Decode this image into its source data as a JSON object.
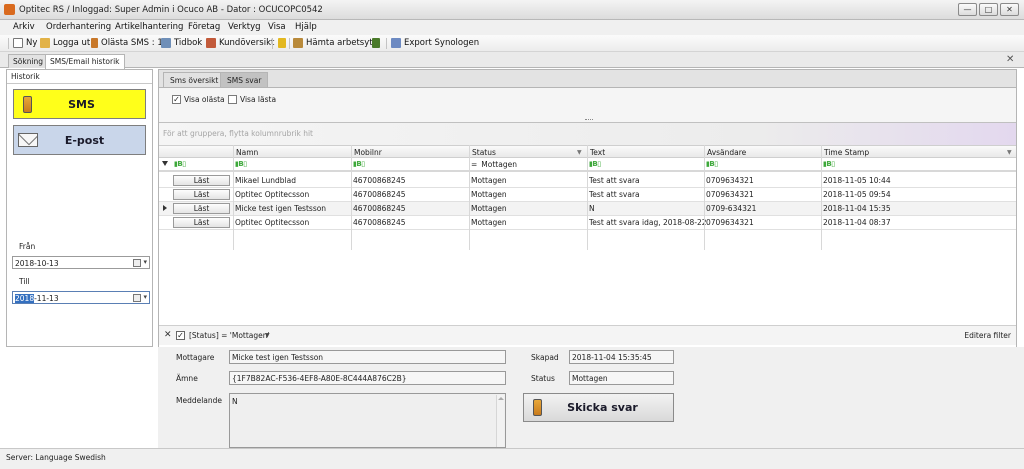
{
  "window": {
    "title": "Optitec RS / Inloggad: Super Admin i  Ocuco AB - Dator : OCUCOPC0542",
    "min": "—",
    "max": "□",
    "close": "✕"
  },
  "menu": [
    "Arkiv",
    "Orderhantering",
    "Artikelhantering",
    "Företag",
    "Verktyg",
    "Visa",
    "Hjälp"
  ],
  "toolbar": {
    "new": "Ny",
    "logout": "Logga ut",
    "unread_sms": "Olästa SMS : 1",
    "timebook": "Tidbok",
    "customer_overview": "Kundöversikt",
    "fetch_workspace": "Hämta arbetsyta",
    "export": "Export Synologen"
  },
  "tabs": {
    "search": "Sökning",
    "history": "SMS/Email historik",
    "close": "✕"
  },
  "left": {
    "header": "Historik",
    "sms_label": "SMS",
    "email_label": "E-post",
    "from_label": "Från",
    "from_value": "2018-10-13",
    "to_label": "Till",
    "to_value_selected": "2018",
    "to_value_rest": "-11-13"
  },
  "right": {
    "tab_overview": "Sms översikt",
    "tab_reply": "SMS svar",
    "show_unread": "Visa olästa",
    "show_read": "Visa lästa",
    "group_hint": "För att gruppera, flytta kolumnrubrik hit",
    "columns": [
      "Namn",
      "Mobilnr",
      "Status",
      "Text",
      "Avsändare",
      "Time Stamp"
    ],
    "filter_status": "Mottagen",
    "button_label": "Läst",
    "rows": [
      {
        "name": "Mikael Lundblad",
        "mobile": "46700868245",
        "status": "Mottagen",
        "text": "Test att svara",
        "sender": "0709634321",
        "time": "2018-11-05 10:44"
      },
      {
        "name": "Optitec Optitecsson",
        "mobile": "46700868245",
        "status": "Mottagen",
        "text": "Test att svara",
        "sender": "0709634321",
        "time": "2018-11-05 09:54"
      },
      {
        "name": "Micke test igen Testsson",
        "mobile": "46700868245",
        "status": "Mottagen",
        "text": "N",
        "sender": "0709-634321",
        "time": "2018-11-04 15:35"
      },
      {
        "name": "Optitec Optitecsson",
        "mobile": "46700868245",
        "status": "Mottagen",
        "text": "Test att svara idag, 2018-08-22",
        "sender": "0709634321",
        "time": "2018-11-04 08:37"
      }
    ],
    "filter_expression": "[Status] = 'Mottagen'",
    "edit_filter": "Editera filter"
  },
  "details": {
    "receiver_label": "Mottagare",
    "receiver_value": "Micke test igen Testsson",
    "subject_label": "Ämne",
    "subject_value": "{1F7B82AC-F536-4EF8-A80E-8C444A876C2B}",
    "message_label": "Meddelande",
    "message_value": "N",
    "created_label": "Skapad",
    "created_value": "2018-11-04 15:35:45",
    "status_label": "Status",
    "status_value": "Mottagen",
    "reply_button": "Skicka svar"
  },
  "statusbar": "Server:  Language  Swedish"
}
